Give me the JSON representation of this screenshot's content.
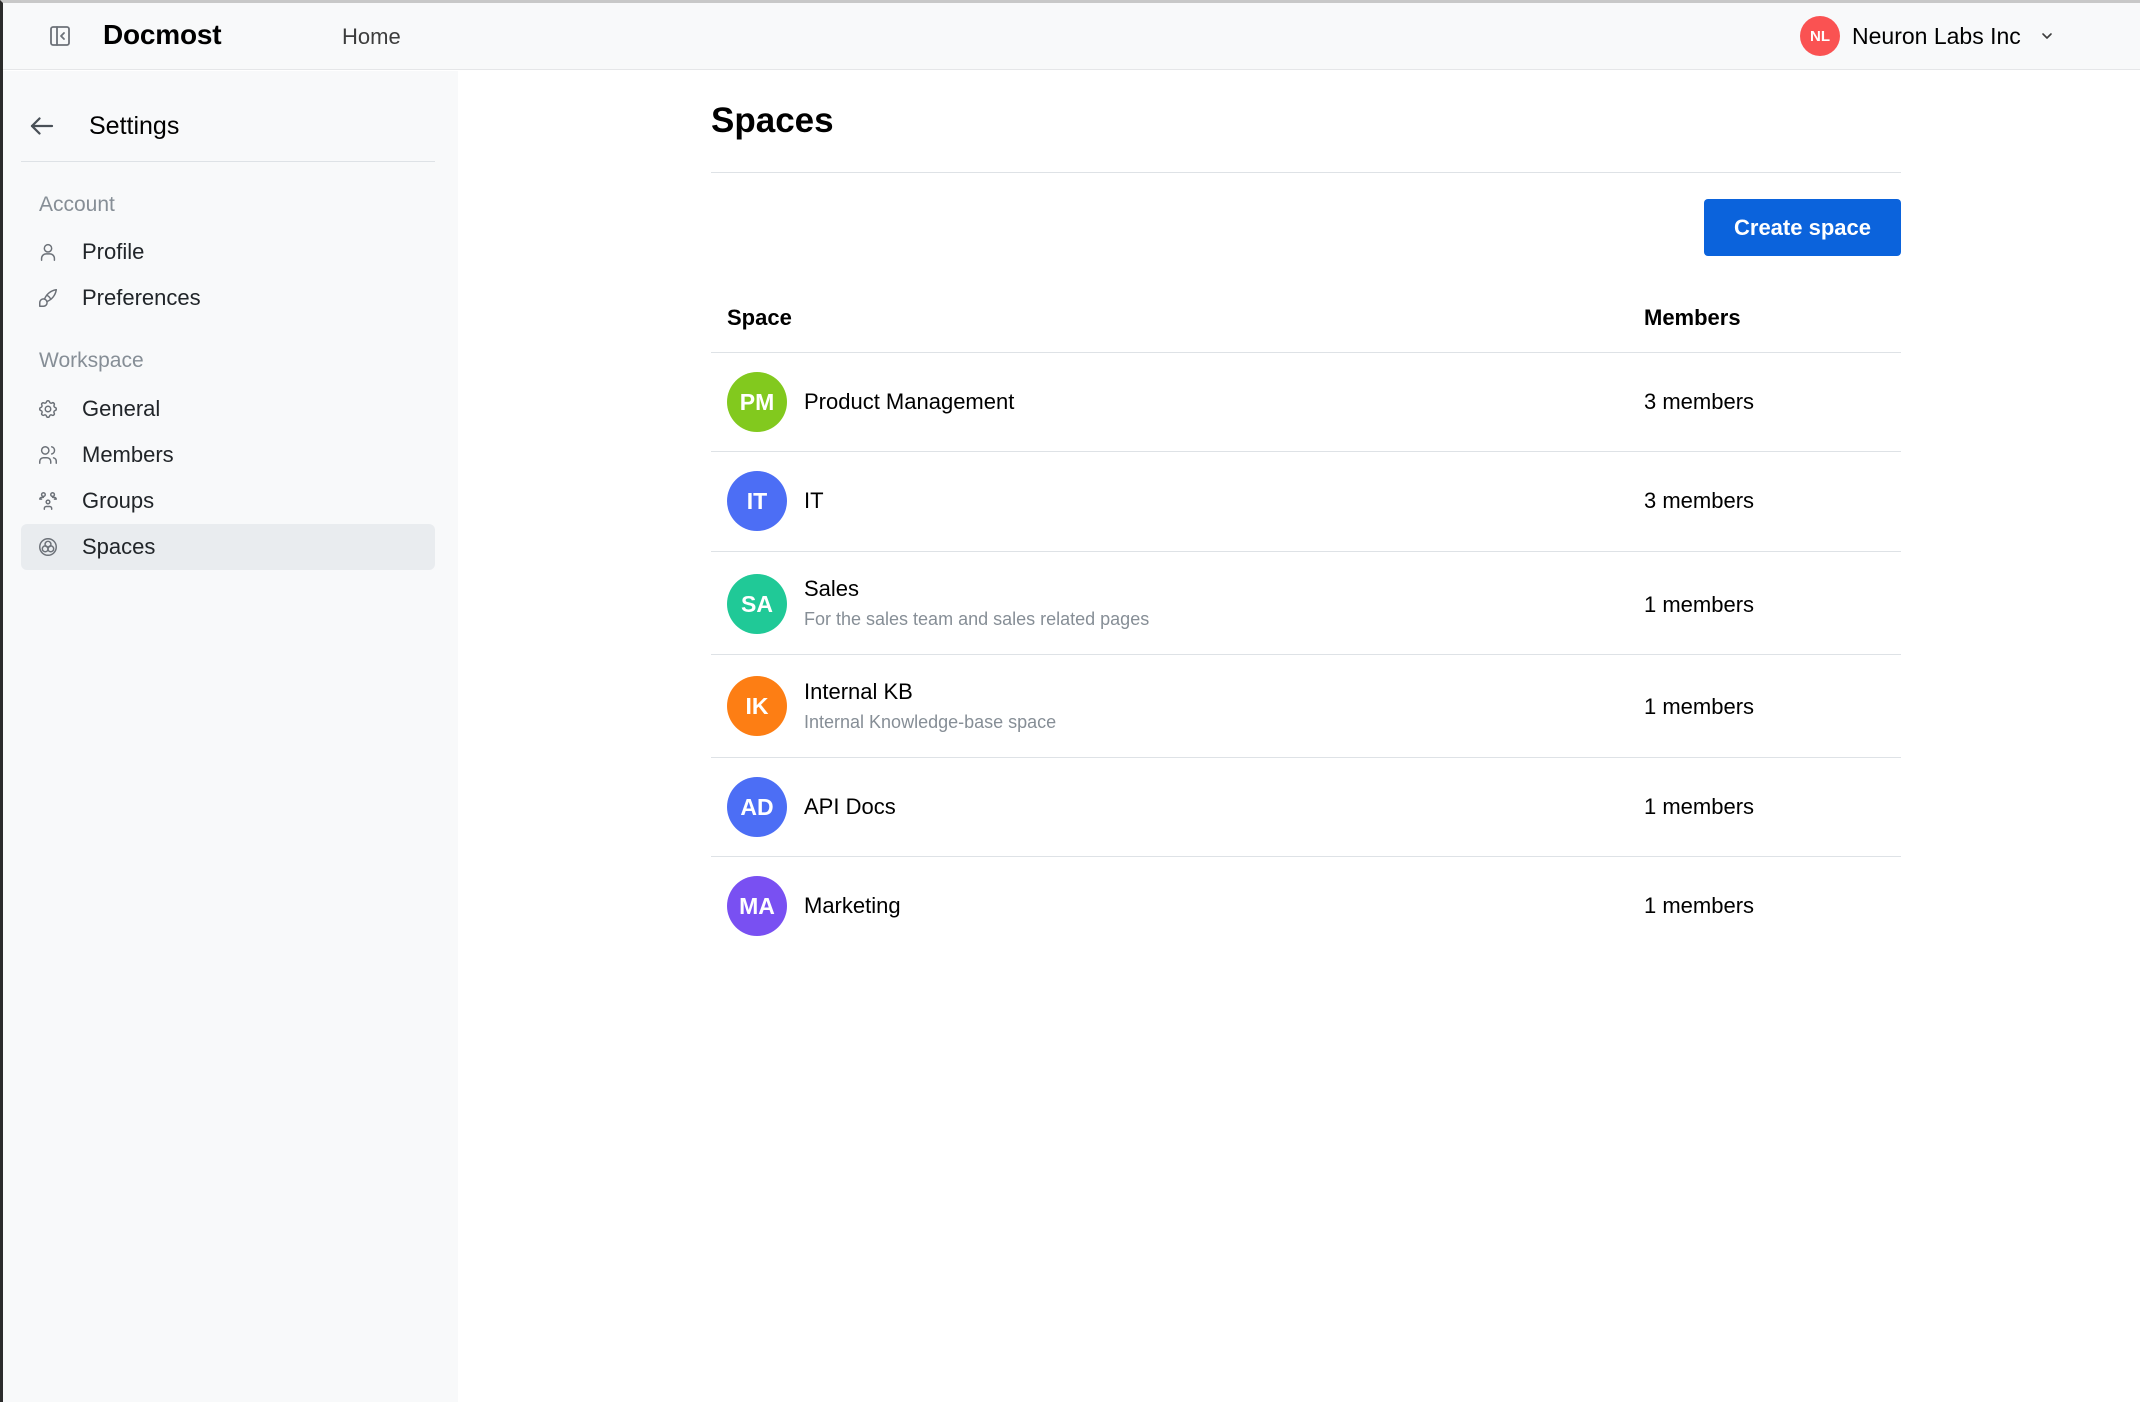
{
  "header": {
    "brand": "Docmost",
    "home_link": "Home",
    "workspace": {
      "initials": "NL",
      "name": "Neuron Labs Inc",
      "avatar_color": "#fa5252"
    }
  },
  "sidebar": {
    "title": "Settings",
    "sections": [
      {
        "label": "Account"
      },
      {
        "label": "Workspace"
      }
    ],
    "items": [
      {
        "label": "Profile",
        "icon": "user-icon"
      },
      {
        "label": "Preferences",
        "icon": "brush-icon"
      },
      {
        "label": "General",
        "icon": "gear-icon"
      },
      {
        "label": "Members",
        "icon": "users-icon"
      },
      {
        "label": "Groups",
        "icon": "groups-icon"
      },
      {
        "label": "Spaces",
        "icon": "spaces-icon",
        "active": true
      }
    ]
  },
  "main": {
    "title": "Spaces",
    "create_button": "Create space",
    "columns": [
      "Space",
      "Members"
    ],
    "rows": [
      {
        "initials": "PM",
        "name": "Product Management",
        "description": "",
        "members": "3 members",
        "color": "#82c91e"
      },
      {
        "initials": "IT",
        "name": "IT",
        "description": "",
        "members": "3 members",
        "color": "#4c6ef5"
      },
      {
        "initials": "SA",
        "name": "Sales",
        "description": "For the sales team and sales related pages",
        "members": "1 members",
        "color": "#20c997"
      },
      {
        "initials": "IK",
        "name": "Internal KB",
        "description": "Internal Knowledge-base space",
        "members": "1 members",
        "color": "#fd7e14"
      },
      {
        "initials": "AD",
        "name": "API Docs",
        "description": "",
        "members": "1 members",
        "color": "#4c6ef5"
      },
      {
        "initials": "MA",
        "name": "Marketing",
        "description": "",
        "members": "1 members",
        "color": "#7950f2"
      }
    ]
  }
}
